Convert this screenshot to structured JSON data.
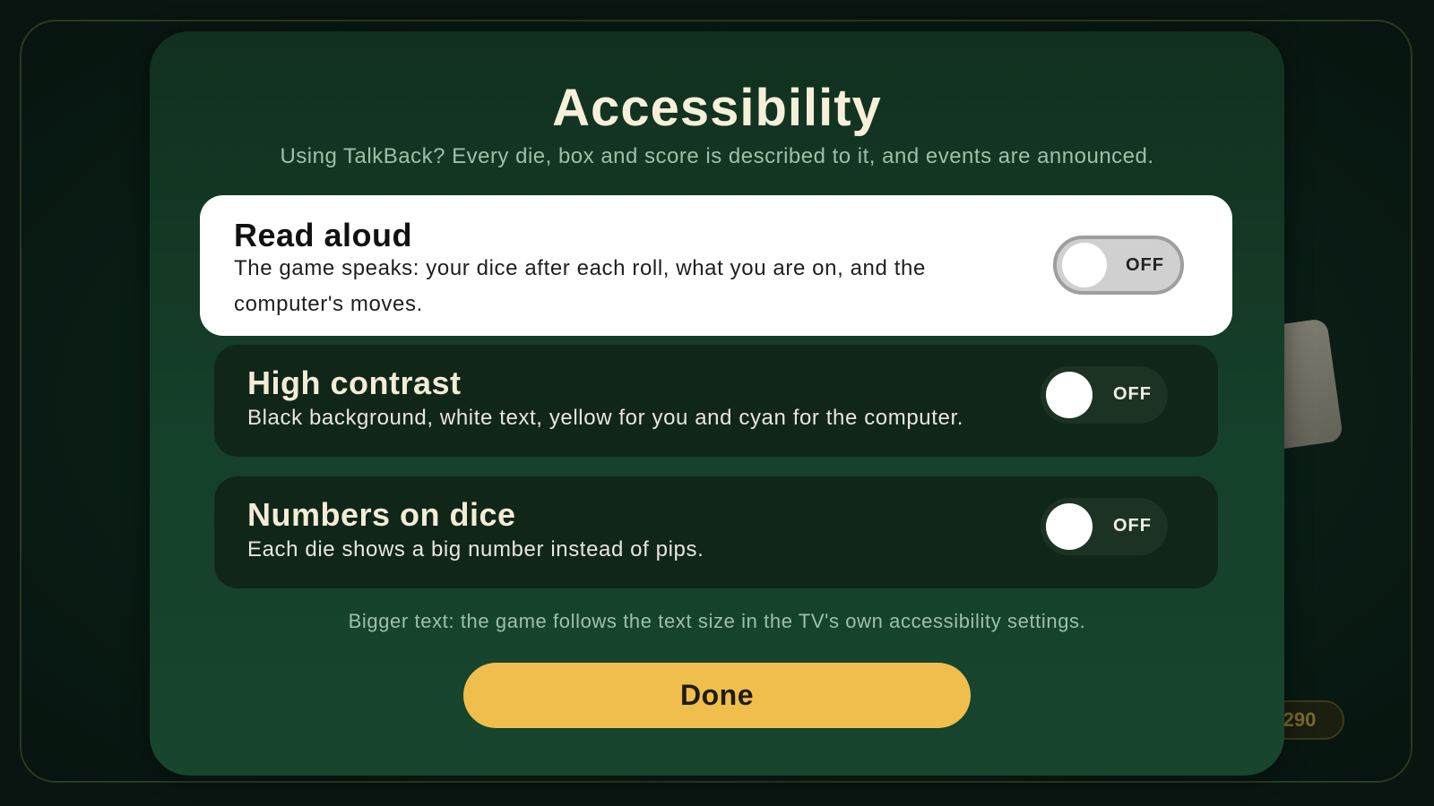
{
  "background": {
    "score_value": "290"
  },
  "dialog": {
    "title": "Accessibility",
    "subtitle": "Using TalkBack? Every die, box and score is described to it, and events are announced.",
    "options": [
      {
        "title": "Read aloud",
        "description": "The game speaks: your dice after each roll, what you are on, and the computer's moves.",
        "toggle_state": "OFF",
        "focused": true
      },
      {
        "title": "High contrast",
        "description": "Black background, white text, yellow for you and cyan for the computer.",
        "toggle_state": "OFF",
        "focused": false
      },
      {
        "title": "Numbers on dice",
        "description": "Each die shows a big number instead of pips.",
        "toggle_state": "OFF",
        "focused": false
      }
    ],
    "footer_note": "Bigger text: the game follows the text size in the TV's own accessibility settings.",
    "done_label": "Done"
  },
  "colors": {
    "accent_button": "#f0be4d",
    "dialog_background": "#15402a",
    "focused_row": "#ffffff",
    "row_background": "#102619"
  }
}
